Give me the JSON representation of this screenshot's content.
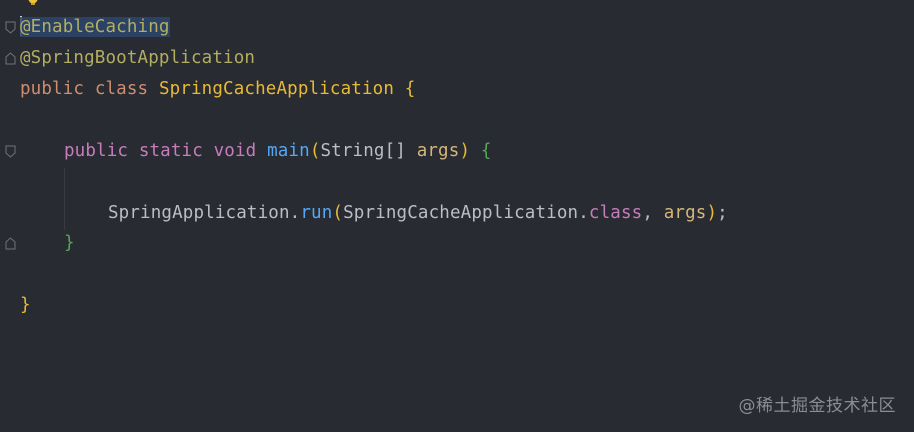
{
  "colors": {
    "background": "#282b32",
    "annotation": "#b3ae60",
    "keyword": "#cf8e6d",
    "class_name": "#e8ba36",
    "method": "#56a8f5",
    "param": "#d5b778",
    "text": "#bcbec4",
    "green_brace": "#54a857",
    "purple_keyword": "#c77dbb"
  },
  "code": {
    "line1": {
      "annotation": "@EnableCaching"
    },
    "line2": {
      "annotation": "@SpringBootApplication"
    },
    "line3": {
      "kw1": "public",
      "kw2": "class",
      "class_name": "SpringCacheApplication",
      "brace": "{"
    },
    "line5": {
      "kw1": "public",
      "kw2": "static",
      "kw3": "void",
      "method": "main",
      "paren_open": "(",
      "param_type": "String[]",
      "param_name": "args",
      "paren_close": ")",
      "brace": "{"
    },
    "line7": {
      "cls": "SpringApplication",
      "dot1": ".",
      "method": "run",
      "paren_open": "(",
      "arg_cls": "SpringCacheApplication",
      "dot2": ".",
      "class_kw": "class",
      "comma": ", ",
      "arg": "args",
      "paren_close": ")",
      "semi": ";"
    },
    "line8": {
      "brace": "}"
    },
    "line10": {
      "brace": "}"
    }
  },
  "icons": {
    "bulb": "lightbulb-icon",
    "fold": "fold-marker-icon"
  },
  "watermark": "@稀土掘金技术社区"
}
